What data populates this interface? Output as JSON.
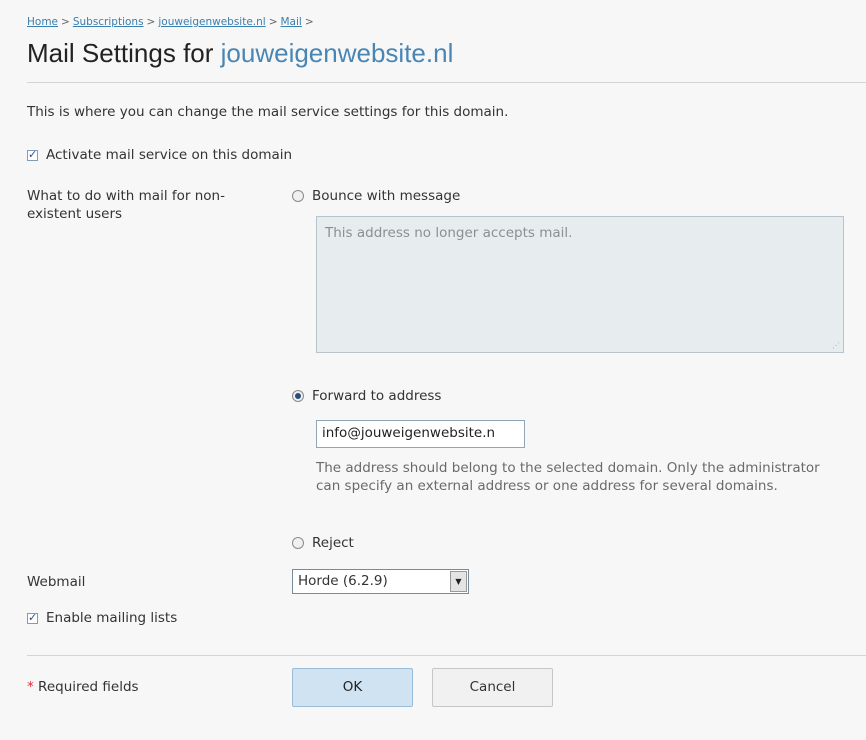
{
  "breadcrumb": {
    "items": [
      "Home",
      "Subscriptions",
      "jouweigenwebsite.nl",
      "Mail"
    ],
    "separator": ">"
  },
  "page": {
    "title_prefix": "Mail Settings for",
    "title_domain": "jouweigenwebsite.nl",
    "intro": "This is where you can change the mail service settings for this domain."
  },
  "form": {
    "activate_mail": {
      "label": "Activate mail service on this domain",
      "checked": true
    },
    "nonexistent_label": "What to do with mail for non-existent users",
    "bounce": {
      "label": "Bounce with message",
      "selected": false,
      "message_placeholder": "This address no longer accepts mail."
    },
    "forward": {
      "label": "Forward to address",
      "selected": true,
      "value": "info@jouweigenwebsite.n",
      "hint": "The address should belong to the selected domain. Only the administrator can specify an external address or one address for several domains."
    },
    "reject": {
      "label": "Reject",
      "selected": false
    },
    "webmail": {
      "label": "Webmail",
      "selected": "Horde (6.2.9)"
    },
    "mailing_lists": {
      "label": "Enable mailing lists",
      "checked": true
    }
  },
  "footer": {
    "required_star": "*",
    "required_label": "Required fields",
    "ok_label": "OK",
    "cancel_label": "Cancel"
  },
  "colors": {
    "link": "#3a7fb0",
    "title_domain": "#4a86b4",
    "ok_button_bg": "#cfe3f3",
    "required_star": "#e0282d"
  }
}
